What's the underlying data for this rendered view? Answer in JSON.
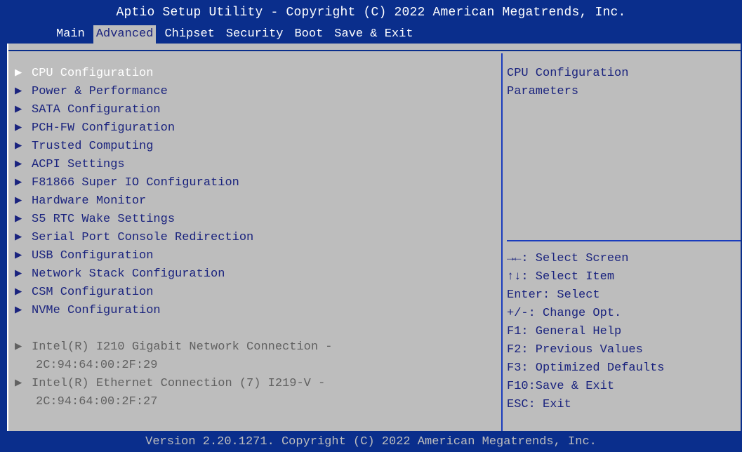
{
  "header": {
    "title": "Aptio Setup Utility - Copyright (C) 2022 American Megatrends, Inc."
  },
  "tabs": [
    {
      "label": "Main"
    },
    {
      "label": "Advanced"
    },
    {
      "label": "Chipset"
    },
    {
      "label": "Security"
    },
    {
      "label": "Boot"
    },
    {
      "label": "Save & Exit"
    }
  ],
  "menu": {
    "items": [
      {
        "label": "CPU Configuration"
      },
      {
        "label": "Power & Performance"
      },
      {
        "label": "SATA Configuration"
      },
      {
        "label": "PCH-FW Configuration"
      },
      {
        "label": "Trusted Computing"
      },
      {
        "label": "ACPI Settings"
      },
      {
        "label": "F81866 Super IO Configuration"
      },
      {
        "label": "Hardware Monitor"
      },
      {
        "label": "S5 RTC Wake Settings"
      },
      {
        "label": "Serial Port Console Redirection"
      },
      {
        "label": "USB Configuration"
      },
      {
        "label": "Network Stack Configuration"
      },
      {
        "label": "CSM Configuration"
      },
      {
        "label": "NVMe Configuration"
      }
    ],
    "network": [
      {
        "label": "Intel(R) I210 Gigabit  Network Connection -",
        "mac": "2C:94:64:00:2F:29"
      },
      {
        "label": "Intel(R) Ethernet Connection (7) I219-V -",
        "mac": "2C:94:64:00:2F:27"
      }
    ]
  },
  "help": {
    "line1": "CPU Configuration",
    "line2": "Parameters"
  },
  "keys": [
    "→←: Select Screen",
    "↑↓: Select Item",
    "Enter: Select",
    "+/-: Change Opt.",
    "F1: General Help",
    "F2: Previous Values",
    "F3: Optimized Defaults",
    "F10:Save & Exit",
    "ESC: Exit"
  ],
  "footer": {
    "text": "Version 2.20.1271. Copyright (C) 2022 American Megatrends, Inc."
  },
  "colors": {
    "background": "#0a2e8c",
    "panel": "#bdbdbd",
    "text": "#1a237e",
    "selected": "#ffffff",
    "disabled": "#616161"
  },
  "icons": {
    "submenu": "triangle-right-icon"
  }
}
